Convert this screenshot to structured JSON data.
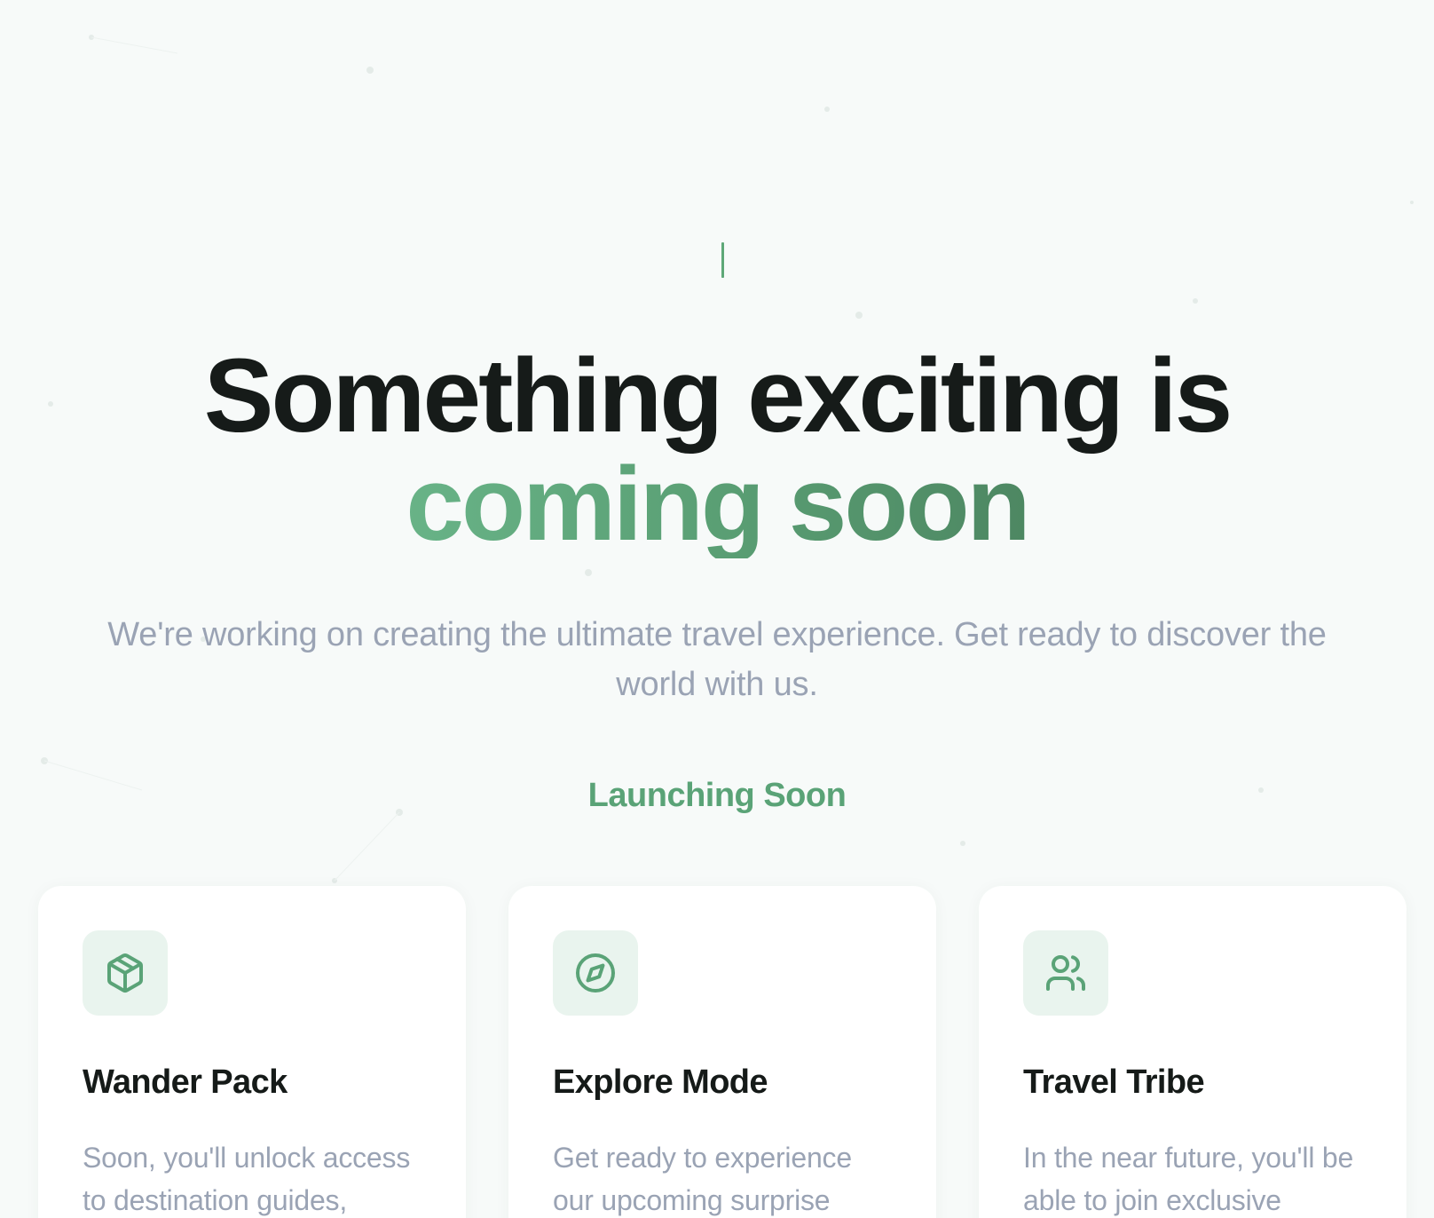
{
  "hero": {
    "headline_line1": "Something exciting is",
    "headline_line2": "coming soon",
    "subtitle": "We're working on creating the ultimate travel experience. Get ready to discover the world with us.",
    "status": "Launching Soon"
  },
  "features": [
    {
      "icon": "package-icon",
      "title": "Wander Pack",
      "description": "Soon, you'll unlock access to destination guides,"
    },
    {
      "icon": "compass-icon",
      "title": "Explore Mode",
      "description": "Get ready to experience our upcoming surprise"
    },
    {
      "icon": "users-icon",
      "title": "Travel Tribe",
      "description": "In the near future, you'll be able to join exclusive"
    }
  ],
  "colors": {
    "background": "#f7faf9",
    "accent": "#5aa377",
    "heading": "#161b19",
    "muted": "#9aa3b4",
    "icon_bg": "#e9f4ee"
  }
}
